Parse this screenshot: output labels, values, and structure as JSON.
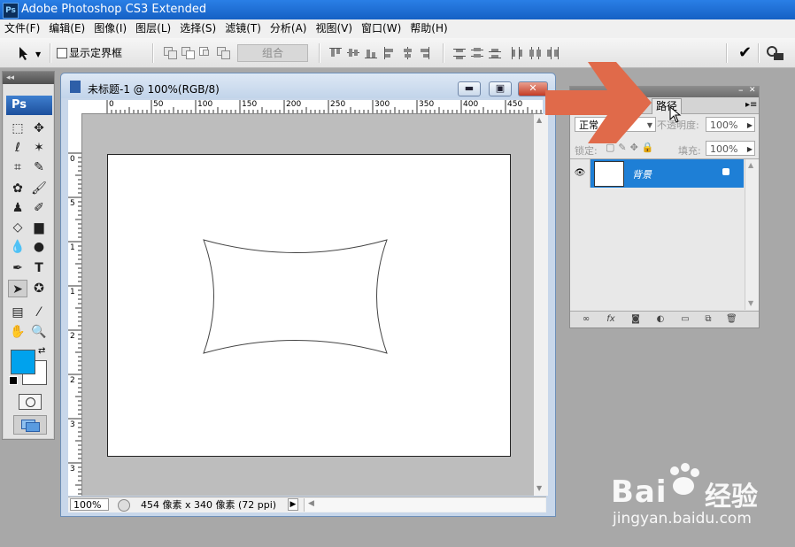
{
  "window": {
    "title": "Adobe Photoshop CS3 Extended"
  },
  "menu": [
    "文件(F)",
    "编辑(E)",
    "图像(I)",
    "图层(L)",
    "选择(S)",
    "滤镜(T)",
    "分析(A)",
    "视图(V)",
    "窗口(W)",
    "帮助(H)"
  ],
  "options_bar": {
    "show_bbox_label": "显示定界框",
    "combine_label": "组合"
  },
  "toolbox": {
    "logo": "Ps"
  },
  "document": {
    "title": "未标题-1 @ 100%(RGB/8)",
    "ruler_h": [
      "0",
      "50",
      "100",
      "150",
      "200",
      "250",
      "300",
      "350",
      "400",
      "450"
    ],
    "ruler_v": [
      "0",
      "5",
      "1",
      "1",
      "2",
      "2",
      "3",
      "3"
    ],
    "zoom": "100%",
    "status_info": "454 像素 x 340 像素 (72 ppi)"
  },
  "panel": {
    "tab_active": "路径",
    "blend_mode": "正常",
    "opacity_label": "不透明度:",
    "opacity_value": "100%",
    "lock_label": "锁定:",
    "fill_label": "填充:",
    "fill_value": "100%",
    "layer_name": "背景"
  },
  "watermark": {
    "brand": "Bai",
    "brand_suffix": "经验",
    "url": "jingyan.baidu.com"
  },
  "colors": {
    "accent": "#1e7fd6",
    "arrow": "#e06a4a",
    "foreground": "#00a2ed",
    "background": "#ffffff"
  }
}
